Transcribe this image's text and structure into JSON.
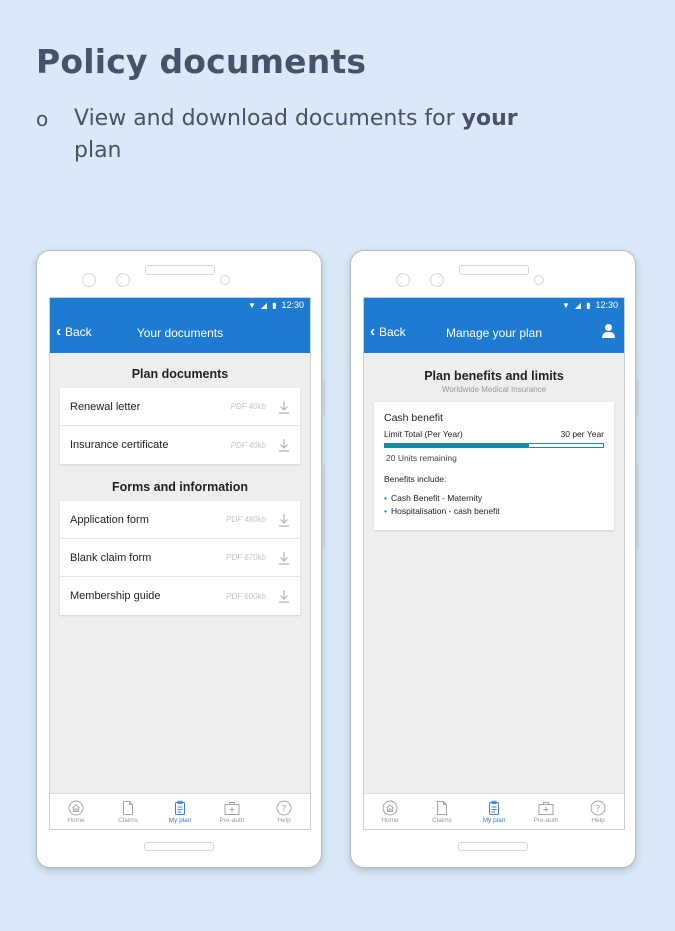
{
  "slide": {
    "title": "Policy documents",
    "bullet_marker": "o",
    "bullet_text_before": "View and download documents for ",
    "bullet_text_bold": "your",
    "bullet_text_after": " plan"
  },
  "status_bar": {
    "time": "12:30"
  },
  "left_phone": {
    "back_label": "Back",
    "app_title": "Your documents",
    "sections": [
      {
        "title": "Plan documents",
        "documents": [
          {
            "name": "Renewal letter",
            "size": "PDF 40kb"
          },
          {
            "name": "Insurance certificate",
            "size": "PDF 40kb"
          }
        ]
      },
      {
        "title": "Forms and information",
        "documents": [
          {
            "name": "Application form",
            "size": "PDF 480kb"
          },
          {
            "name": "Blank claim form",
            "size": "PDF 670kb"
          },
          {
            "name": "Membership guide",
            "size": "PDF 600kb"
          }
        ]
      }
    ]
  },
  "right_phone": {
    "back_label": "Back",
    "app_title": "Manage your plan",
    "plan_title": "Plan benefits and limits",
    "plan_subtitle": "Worldwide Medical Insurance",
    "benefit": {
      "name": "Cash benefit",
      "limit_label": "Limit Total (Per Year)",
      "limit_value": "30 per Year",
      "used_fraction": 0.66,
      "units_remaining": "20 Units remaining",
      "includes_label": "Benefits include:",
      "includes": [
        "Cash Benefit - Maternity",
        "Hospitalisation - cash benefit"
      ]
    }
  },
  "nav": {
    "items": [
      {
        "label": "Home",
        "icon": "home-icon"
      },
      {
        "label": "Claims",
        "icon": "document-icon"
      },
      {
        "label": "My plan",
        "icon": "clipboard-icon",
        "active": true
      },
      {
        "label": "Pre-auth",
        "icon": "medical-kit-icon"
      },
      {
        "label": "Help",
        "icon": "help-icon"
      }
    ]
  },
  "colors": {
    "primary": "#1d7bd1",
    "progress": "#1a8aa0",
    "page_bg": "#d9e9f7",
    "heading": "#44536b"
  }
}
